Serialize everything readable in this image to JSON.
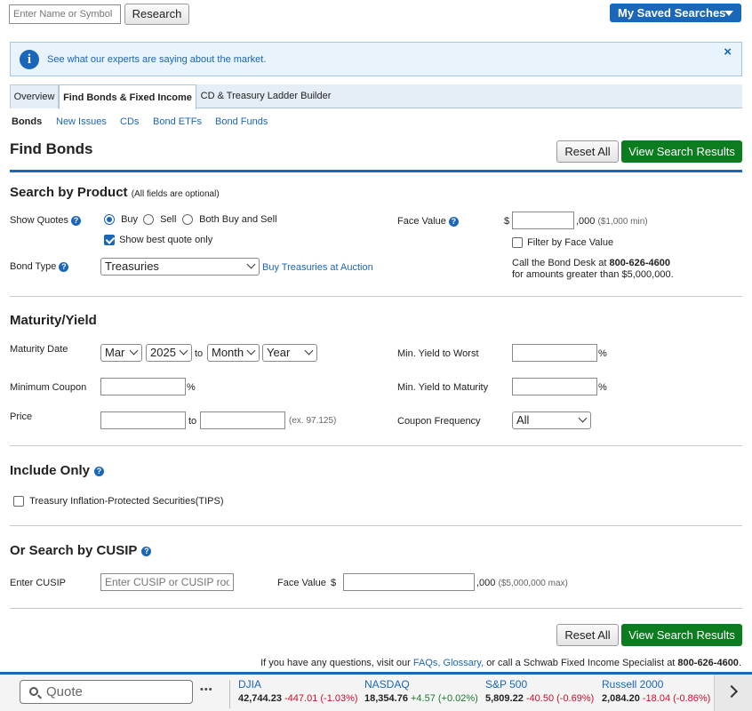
{
  "header": {
    "search_placeholder": "Enter Name or Symbol",
    "research_label": "Research",
    "saved_searches_label": "My Saved Searches"
  },
  "banner": {
    "text": "See what our experts are saying about the market.",
    "close": "×"
  },
  "tabs": [
    {
      "label": "Overview"
    },
    {
      "label": "Find Bonds & Fixed Income"
    },
    {
      "label": "CD & Treasury Ladder Builder"
    }
  ],
  "subnav": [
    {
      "label": "Bonds"
    },
    {
      "label": "New Issues"
    },
    {
      "label": "CDs"
    },
    {
      "label": "Bond ETFs"
    },
    {
      "label": "Bond Funds"
    }
  ],
  "page": {
    "title": "Find Bonds",
    "reset_label": "Reset All",
    "view_results_label": "View Search Results"
  },
  "product": {
    "title": "Search by Product",
    "subtitle": "(All fields are optional)",
    "show_quotes_label": "Show Quotes",
    "radio_buy": "Buy",
    "radio_sell": "Sell",
    "radio_both": "Both Buy and Sell",
    "best_quote_label": "Show best quote only",
    "bond_type_label": "Bond Type",
    "bond_type_value": "Treasuries",
    "auction_link": "Buy Treasuries at Auction",
    "face_value_label": "Face Value",
    "dollar": "$",
    "thousand_suffix": ",000",
    "face_hint": "($1,000 min)",
    "filter_face_label": "Filter by Face Value",
    "call_text_1": "Call the Bond Desk at ",
    "call_phone": "800-626-4600",
    "call_text_2": "for amounts greater than $5,000,000."
  },
  "maturity": {
    "title": "Maturity/Yield",
    "maturity_date_label": "Maturity Date",
    "month_from": "Mar",
    "year_from": "2025",
    "to": "to",
    "month_to": "Month",
    "year_to": "Year",
    "min_coupon_label": "Minimum Coupon",
    "percent": "%",
    "price_label": "Price",
    "price_hint": "(ex. 97.125)",
    "min_ytw_label": "Min. Yield to Worst",
    "min_ytm_label": "Min. Yield to Maturity",
    "coupon_freq_label": "Coupon Frequency",
    "coupon_freq_value": "All"
  },
  "include": {
    "title": "Include Only",
    "tips_label": "Treasury Inflation-Protected Securities(TIPS)"
  },
  "cusip": {
    "title": "Or Search by CUSIP",
    "enter_label": "Enter CUSIP",
    "placeholder": "Enter CUSIP or CUSIP root",
    "face_value_label": "Face Value",
    "dollar": "$",
    "thousand_suffix": ",000",
    "hint": "($5,000,000 max)"
  },
  "footer_note": {
    "prefix": "If you have any questions, visit our ",
    "faqs": "FAQs,",
    "glossary": "Glossary,",
    "middle": " or call a Schwab Fixed Income Specialist at ",
    "phone": "800-626-4600",
    "suffix": "."
  },
  "ticker": {
    "quote_placeholder": "Quote",
    "more": "•••",
    "items": [
      {
        "name": "DJIA",
        "value": "42,744.23",
        "change": "-447.01 (-1.03%)",
        "dir": "down"
      },
      {
        "name": "NASDAQ",
        "value": "18,354.76",
        "change": "+4.57 (+0.02%)",
        "dir": "up"
      },
      {
        "name": "S&P 500",
        "value": "5,809.22",
        "change": "-40.50 (-0.69%)",
        "dir": "down"
      },
      {
        "name": "Russell 2000",
        "value": "2,084.20",
        "change": "-18.04 (-0.86%)",
        "dir": "down"
      }
    ]
  },
  "colors": {
    "accent": "#1a66b8",
    "green_button": "#0b7d1f",
    "banner_bg": "#e8f3fb",
    "negative": "#c8102e",
    "positive": "#1d7a2e"
  }
}
